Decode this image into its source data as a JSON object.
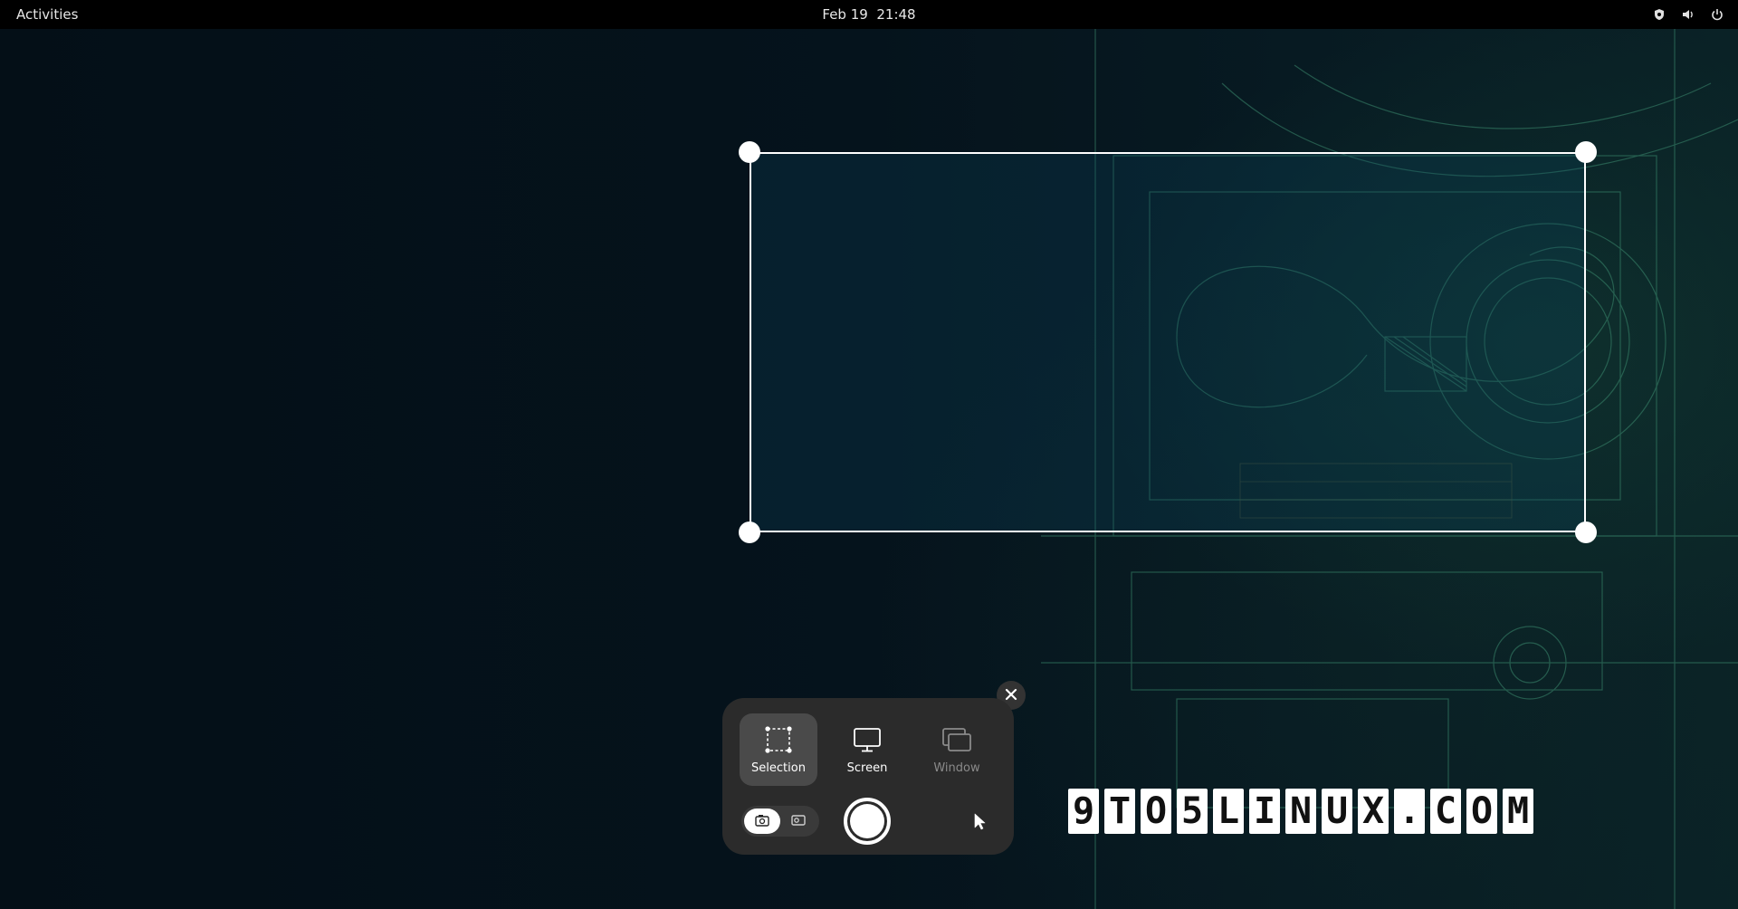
{
  "topbar": {
    "activities_label": "Activities",
    "date": "Feb 19",
    "time": "21:48",
    "tray_icons": [
      "shield-icon",
      "volume-icon",
      "power-icon"
    ]
  },
  "screenshot_ui": {
    "modes": [
      {
        "label": "Selection",
        "icon": "selection-icon",
        "state": "active"
      },
      {
        "label": "Screen",
        "icon": "monitor-icon",
        "state": "normal"
      },
      {
        "label": "Window",
        "icon": "window-icon",
        "state": "disabled"
      }
    ],
    "capture_type_toggle": {
      "options": [
        "screenshot-icon",
        "screencast-icon"
      ],
      "selected": "screenshot-icon"
    },
    "capture_button_icon": "capture-icon",
    "pointer_toggle_icon": "pointer-icon",
    "close_icon": "close-icon"
  },
  "watermark": {
    "chars": [
      "9",
      "T",
      "O",
      "5",
      "L",
      "I",
      "N",
      "U",
      "X",
      ".",
      "C",
      "O",
      "M"
    ]
  },
  "colors": {
    "topbar_bg": "#000000",
    "panel_bg": "#2b2b2b",
    "active_mode_bg": "#4a4a4a",
    "selection_border": "#ffffff"
  }
}
